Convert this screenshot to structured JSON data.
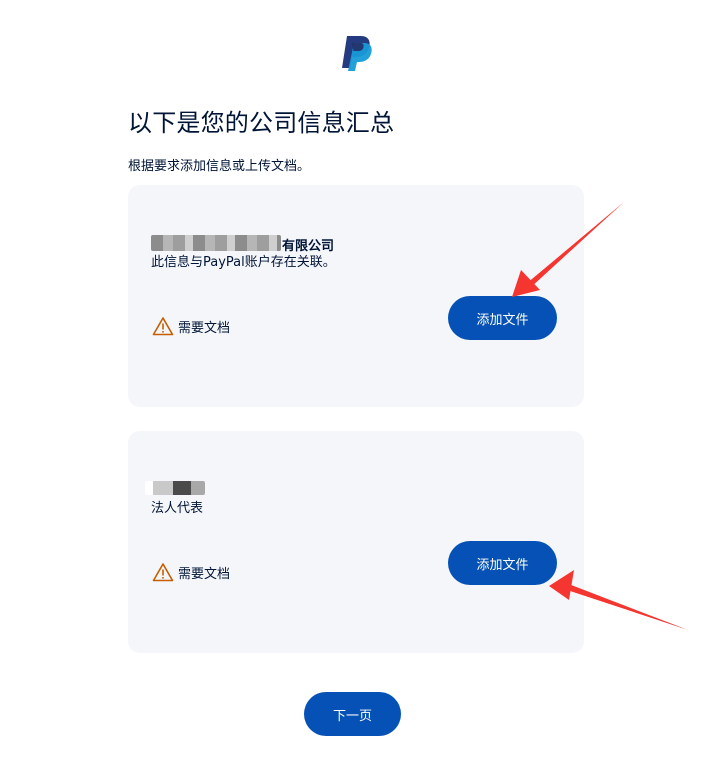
{
  "header": {
    "logo_icon": "paypal-logo-icon",
    "title": "以下是您的公司信息汇总",
    "subtitle": "根据要求添加信息或上传文档。"
  },
  "cards": [
    {
      "entity_name": "有限公司",
      "description": "此信息与PayPal账户存在关联。",
      "status_icon": "warning-icon",
      "status_label": "需要文档",
      "button_label": "添加文件"
    },
    {
      "entity_name": "",
      "description": "法人代表",
      "status_icon": "warning-icon",
      "status_label": "需要文档",
      "button_label": "添加文件"
    }
  ],
  "footer": {
    "next_label": "下一页"
  },
  "colors": {
    "primary": "#0551b5",
    "card_bg": "#f5f6fa",
    "warning": "#c55e00",
    "annotation_arrow": "#f5352f",
    "text": "#001435"
  }
}
